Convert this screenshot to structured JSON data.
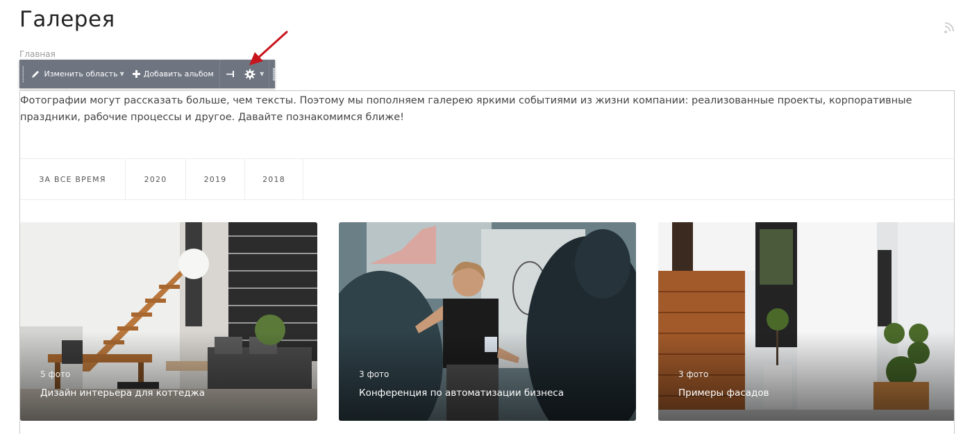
{
  "page": {
    "title": "Галерея",
    "breadcrumb": "Главная"
  },
  "toolbar": {
    "edit_area_label": "Изменить область",
    "add_album_label": "Добавить альбом",
    "icons": [
      "drag-handle-icon",
      "pencil-icon",
      "plus-icon",
      "pin-icon",
      "gear-icon",
      "resize-handle-icon"
    ]
  },
  "intro_text": "Фотографии могут рассказать больше, чем тексты. Поэтому мы пополняем галерею яркими событиями из жизни компании: реализованные проекты, корпоративные праздники, рабочие процессы и другое. Давайте познакомимся ближе!",
  "filters": {
    "tabs": [
      {
        "label": "ЗА ВСЕ ВРЕМЯ"
      },
      {
        "label": "2020"
      },
      {
        "label": "2019"
      },
      {
        "label": "2018"
      }
    ]
  },
  "albums": [
    {
      "count": "5 фото",
      "title": "Дизайн интерьера для коттеджа"
    },
    {
      "count": "3 фото",
      "title": "Конференция по автоматизации бизнеса"
    },
    {
      "count": "3 фото",
      "title": "Примеры фасадов"
    }
  ],
  "colors": {
    "toolbar_bg": "#6e7480",
    "annotation_arrow": "#c8141c",
    "border": "#c8c8c8"
  }
}
